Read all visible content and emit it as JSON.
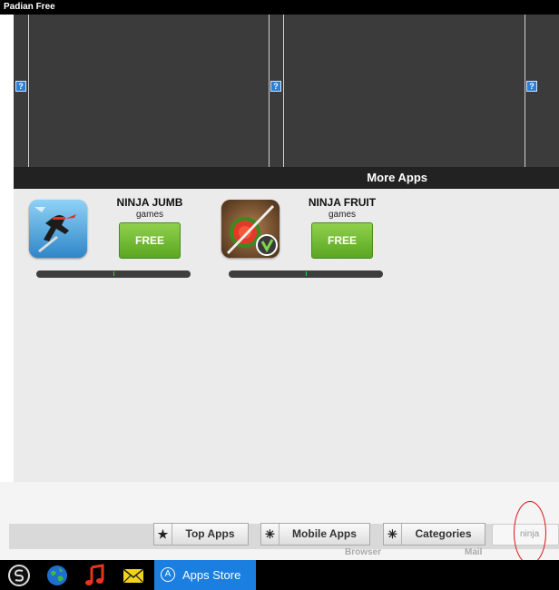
{
  "window": {
    "title": "Padian Free"
  },
  "banner": {
    "broken_image_glyph": "?"
  },
  "more_apps": {
    "title": "More Apps"
  },
  "apps": [
    {
      "title": "NINJA JUMB",
      "category": "games",
      "action": "FREE",
      "icon": "ninja-jump-app-icon",
      "progress": 0.5
    },
    {
      "title": "NINJA FRUIT",
      "category": "games",
      "action": "FREE",
      "icon": "ninja-fruit-app-icon",
      "progress": 0.5
    }
  ],
  "nav_tabs": [
    {
      "label": "Top Apps",
      "icon": "star-icon",
      "glyph": "★"
    },
    {
      "label": "Mobile Apps",
      "icon": "sunburst-icon",
      "glyph": "✳"
    },
    {
      "label": "Categories",
      "icon": "sunburst-icon",
      "glyph": "✳"
    }
  ],
  "search": {
    "value": "ninja"
  },
  "dock": {
    "browser_label": "Browser",
    "mail_label": "Mail"
  },
  "taskbar": {
    "active_app": "Apps Store",
    "icons": [
      "settings-icon",
      "globe-icon",
      "music-icon",
      "mail-icon",
      "apps-store-icon"
    ]
  },
  "colors": {
    "free_button": "#6ab82e",
    "active_tab": "#1a7fe0",
    "annotation_circle": "#d11111"
  }
}
